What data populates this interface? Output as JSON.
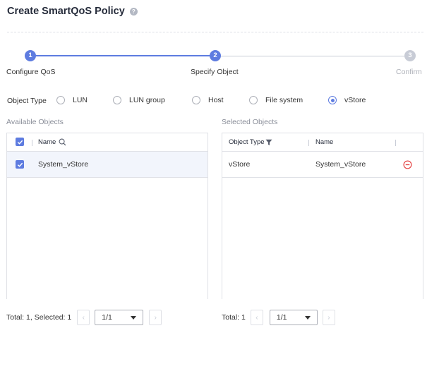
{
  "page": {
    "title": "Create SmartQoS Policy",
    "help_icon": "?"
  },
  "steps": [
    {
      "number": "1",
      "label": "Configure QoS",
      "state": "completed"
    },
    {
      "number": "2",
      "label": "Specify Object",
      "state": "current"
    },
    {
      "number": "3",
      "label": "Confirm",
      "state": "pending"
    }
  ],
  "object_type": {
    "label": "Object Type",
    "options": [
      "LUN",
      "LUN group",
      "Host",
      "File system",
      "vStore"
    ],
    "selected": "vStore"
  },
  "available": {
    "title": "Available Objects",
    "column_name": "Name",
    "rows": [
      {
        "name": "System_vStore",
        "checked": true
      }
    ],
    "pager": {
      "total_text": "Total: 1, Selected: 1",
      "page": "1/1"
    }
  },
  "selected": {
    "title": "Selected Objects",
    "column_type": "Object Type",
    "column_name": "Name",
    "rows": [
      {
        "type": "vStore",
        "name": "System_vStore"
      }
    ],
    "pager": {
      "total_text": "Total: 1",
      "page": "1/1"
    }
  },
  "colors": {
    "accent": "#5e7ce0",
    "remove": "#e54545",
    "inactive": "#c8ccd6"
  }
}
